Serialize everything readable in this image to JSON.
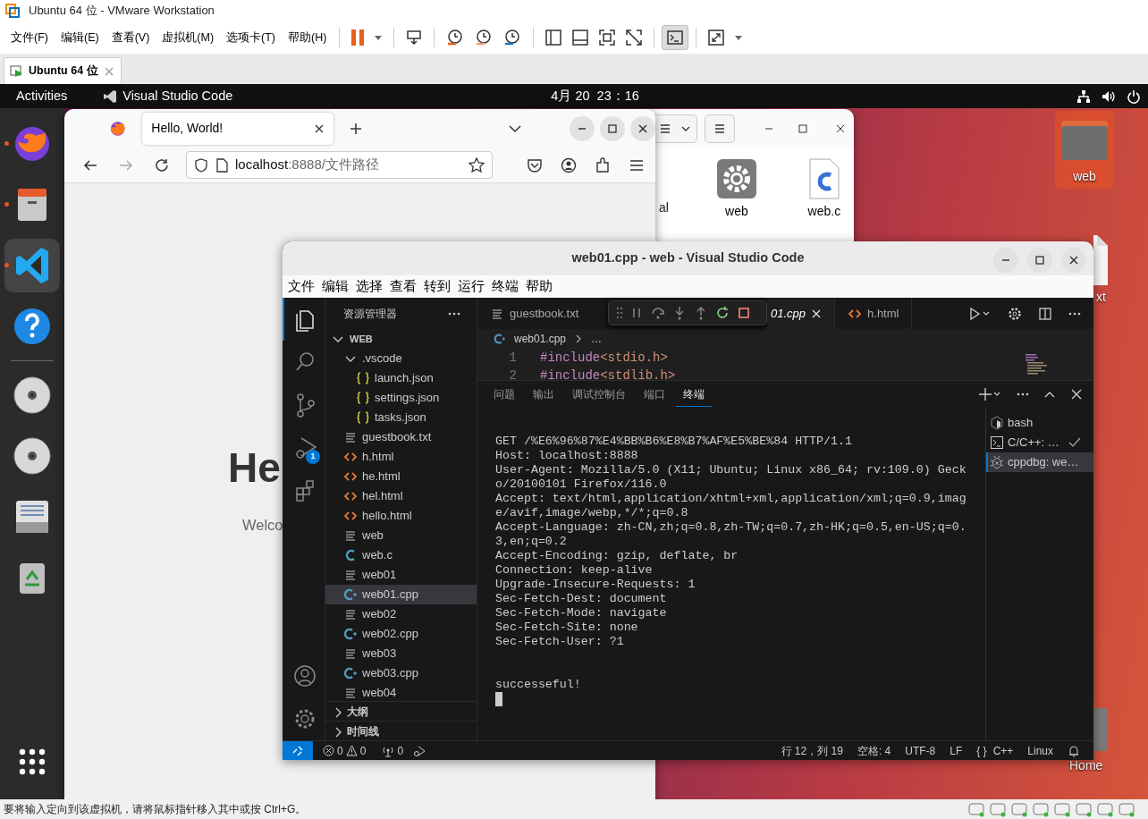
{
  "vmware": {
    "title": "Ubuntu 64 位 - VMware Workstation",
    "menu": [
      "文件(F)",
      "编辑(E)",
      "查看(V)",
      "虚拟机(M)",
      "选项卡(T)",
      "帮助(H)"
    ],
    "tabs": [
      {
        "label": "Ubuntu 64 位",
        "selected": true
      }
    ],
    "status_text": "要将输入定向到该虚拟机，请将鼠标指针移入其中或按 Ctrl+G。"
  },
  "topbar": {
    "activities": "Activities",
    "app": "Visual Studio Code",
    "clock": "4月 20  23：16"
  },
  "dock": [
    {
      "kind": "browser",
      "running": true,
      "selected": false
    },
    {
      "kind": "files",
      "running": true,
      "selected": false
    },
    {
      "kind": "editor",
      "running": true,
      "selected": true
    },
    {
      "kind": "help",
      "running": false,
      "selected": false
    },
    {
      "kind": "disc",
      "running": false,
      "selected": false
    },
    {
      "kind": "disc",
      "running": false,
      "selected": false
    },
    {
      "kind": "drive",
      "running": false,
      "selected": false
    },
    {
      "kind": "trash",
      "running": false,
      "selected": false
    }
  ],
  "desktop_icons": [
    {
      "kind": "folder",
      "label": "web",
      "selected": true
    },
    {
      "kind": "file",
      "label": "xt",
      "selected": false
    },
    {
      "kind": "home",
      "label": "Home",
      "selected": false
    }
  ],
  "files_window": {
    "partial_label": "al",
    "items": [
      {
        "kind": "gear",
        "label": "web"
      },
      {
        "kind": "c",
        "label": "web.c"
      }
    ]
  },
  "browser": {
    "tab": "Hello, World!",
    "url_host": "localhost",
    "url_rest": ":8888/文件路径",
    "heading": "He",
    "text": "Welco"
  },
  "vscode": {
    "title": "web01.cpp - web - Visual Studio Code",
    "menu": [
      "文件",
      "编辑",
      "选择",
      "查看",
      "转到",
      "运行",
      "终端",
      "帮助"
    ],
    "activity": [
      {
        "kind": "explorer",
        "selected": true
      },
      {
        "kind": "search",
        "selected": false
      },
      {
        "kind": "scm",
        "selected": false
      },
      {
        "kind": "debug",
        "selected": false,
        "badge": "1"
      },
      {
        "kind": "extensions",
        "selected": false
      }
    ],
    "explorer": {
      "title": "资源管理器",
      "tree": [
        {
          "name": "WEB",
          "kind": "root",
          "expanded": true,
          "selected": false,
          "children": [
            {
              "name": ".vscode",
              "kind": "folder",
              "expanded": true,
              "selected": false,
              "children": [
                {
                  "name": "launch.json",
                  "kind": "json",
                  "selected": false
                },
                {
                  "name": "settings.json",
                  "kind": "json",
                  "selected": false
                },
                {
                  "name": "tasks.json",
                  "kind": "json",
                  "selected": false
                }
              ]
            },
            {
              "name": "guestbook.txt",
              "kind": "text",
              "selected": false
            },
            {
              "name": "h.html",
              "kind": "html",
              "selected": false
            },
            {
              "name": "he.html",
              "kind": "html",
              "selected": false
            },
            {
              "name": "hel.html",
              "kind": "html",
              "selected": false
            },
            {
              "name": "hello.html",
              "kind": "html",
              "selected": false
            },
            {
              "name": "web",
              "kind": "text",
              "selected": false
            },
            {
              "name": "web.c",
              "kind": "c",
              "selected": false
            },
            {
              "name": "web01",
              "kind": "text",
              "selected": false
            },
            {
              "name": "web01.cpp",
              "kind": "cpp",
              "selected": true
            },
            {
              "name": "web02",
              "kind": "text",
              "selected": false
            },
            {
              "name": "web02.cpp",
              "kind": "cpp",
              "selected": false
            },
            {
              "name": "web03",
              "kind": "text",
              "selected": false
            },
            {
              "name": "web03.cpp",
              "kind": "cpp",
              "selected": false
            },
            {
              "name": "web04",
              "kind": "text",
              "selected": false
            }
          ]
        }
      ],
      "sections": [
        {
          "label": "大纲",
          "expanded": false
        },
        {
          "label": "时间线",
          "expanded": false
        }
      ]
    },
    "tabs": [
      {
        "label": "guestbook.txt",
        "kind": "text",
        "selected": false
      },
      {
        "label": "01.cpp",
        "selected": true
      },
      {
        "label": "h.html",
        "kind": "html",
        "selected": false
      }
    ],
    "breadcrumb": [
      "web01.cpp",
      "…"
    ],
    "code": [
      {
        "line": "1",
        "directive": "#include",
        "header": "<stdio.h>"
      },
      {
        "line": "2",
        "directive": "#include",
        "header": "<stdlib.h>"
      }
    ],
    "panel_tabs": [
      {
        "label": "问题",
        "selected": false
      },
      {
        "label": "输出",
        "selected": false
      },
      {
        "label": "调试控制台",
        "selected": false
      },
      {
        "label": "端口",
        "selected": false
      },
      {
        "label": "终端",
        "selected": true
      }
    ],
    "terminal_lines": [
      "GET /%E6%96%87%E4%BB%B6%E8%B7%AF%E5%BE%84 HTTP/1.1",
      "Host: localhost:8888",
      "User-Agent: Mozilla/5.0 (X11; Ubuntu; Linux x86_64; rv:109.0) Geck",
      "o/20100101 Firefox/116.0",
      "Accept: text/html,application/xhtml+xml,application/xml;q=0.9,imag",
      "e/avif,image/webp,*/*;q=0.8",
      "Accept-Language: zh-CN,zh;q=0.8,zh-TW;q=0.7,zh-HK;q=0.5,en-US;q=0.",
      "3,en;q=0.2",
      "Accept-Encoding: gzip, deflate, br",
      "Connection: keep-alive",
      "Upgrade-Insecure-Requests: 1",
      "Sec-Fetch-Dest: document",
      "Sec-Fetch-Mode: navigate",
      "Sec-Fetch-Site: none",
      "Sec-Fetch-User: ?1",
      "successeful!"
    ],
    "terminals": [
      {
        "label": "bash",
        "kind": "shell",
        "selected": false,
        "done": false
      },
      {
        "label": "C/C++: …",
        "kind": "task",
        "selected": false,
        "done": true
      },
      {
        "label": "cppdbg: we…",
        "kind": "debug",
        "selected": true,
        "done": false
      }
    ],
    "status": {
      "errors": "0",
      "warnings": "0",
      "ports": "0",
      "position": "行 12，列 19",
      "indent": "空格: 4",
      "encoding": "UTF-8",
      "eol": "LF",
      "language_icon": "{ }",
      "language": "C++",
      "os": "Linux"
    }
  }
}
